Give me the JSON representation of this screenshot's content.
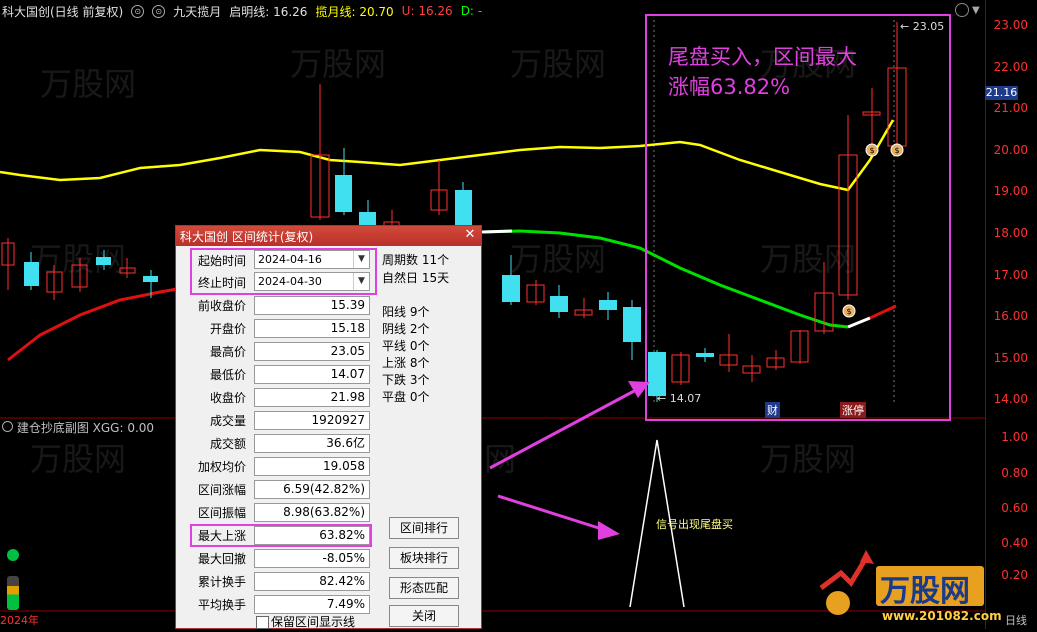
{
  "header": {
    "stock_title": "科大国创(日线 前复权)",
    "indicator_name": "九天揽月",
    "launch_label": "启明线:",
    "launch_value": "16.26",
    "grab_label": "揽月线:",
    "grab_value": "20.70",
    "u_label": "U:",
    "u_value": "16.26",
    "d_label": "D:",
    "d_value": "-"
  },
  "y_axis": {
    "ticks": [
      "23.00",
      "22.00",
      "21.00",
      "20.00",
      "19.00",
      "18.00",
      "17.00",
      "16.00",
      "15.00",
      "14.00"
    ],
    "current_price": "21.16",
    "sub_ticks": [
      "1.00",
      "0.80",
      "0.60",
      "0.40",
      "0.20"
    ]
  },
  "sub_chart": {
    "title": "建仓抄底副图 XGG: 0.00",
    "signal_text": "信号出现尾盘买"
  },
  "date_axis": {
    "year": "2024年",
    "period": "日线"
  },
  "chart_labels": {
    "max_price": "23.05",
    "min_price": "14.07",
    "badge_caiwu": "财",
    "badge_zhangting": "涨停"
  },
  "annotation": {
    "line1": "尾盘买入，区间最大",
    "line2": "涨幅63.82%"
  },
  "dialog": {
    "title": "科大国创 区间统计(复权)",
    "start_label": "起始时间",
    "start_value": "2024-04-16",
    "end_label": "终止时间",
    "end_value": "2024-04-30",
    "rows": [
      {
        "label": "前收盘价",
        "value": "15.39"
      },
      {
        "label": "开盘价",
        "value": "15.18"
      },
      {
        "label": "最高价",
        "value": "23.05"
      },
      {
        "label": "最低价",
        "value": "14.07"
      },
      {
        "label": "收盘价",
        "value": "21.98"
      },
      {
        "label": "成交量",
        "value": "1920927"
      },
      {
        "label": "成交额",
        "value": "36.6亿"
      },
      {
        "label": "加权均价",
        "value": "19.058"
      },
      {
        "label": "区间涨幅",
        "value": "6.59(42.82%)"
      },
      {
        "label": "区间振幅",
        "value": "8.98(63.82%)"
      },
      {
        "label": "最大上涨",
        "value": "63.82%"
      },
      {
        "label": "最大回撤",
        "value": "-8.05%"
      },
      {
        "label": "累计换手",
        "value": "82.42%"
      },
      {
        "label": "平均换手",
        "value": "7.49%"
      }
    ],
    "stats": {
      "period_count": "周期数 11个",
      "natural_days": "自然日 15天",
      "up_lines": "阳线 9个",
      "down_lines": "阴线 2个",
      "flat_lines": "平线 0个",
      "rise": "上涨 8个",
      "fall": "下跌 3个",
      "flat": "平盘 0个"
    },
    "buttons": {
      "range_rank": "区间排行",
      "sector_rank": "板块排行",
      "pattern_match": "形态匹配",
      "close": "关闭"
    },
    "keep_display_label": "保留区间显示线"
  },
  "logo": {
    "text": "万股网",
    "url": "www.201082.com"
  },
  "colors": {
    "bull": "#ff3030",
    "bear": "#40e0f0",
    "ma_yellow": "#ffff00",
    "ma_green": "#00e000",
    "highlight": "#e040e0"
  }
}
